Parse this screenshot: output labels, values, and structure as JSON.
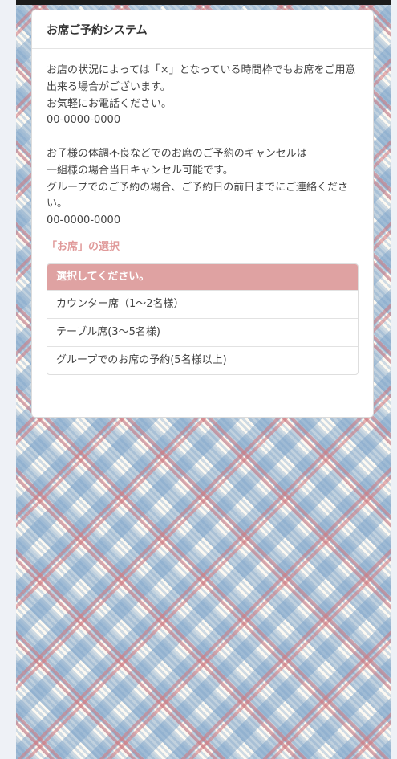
{
  "header": {
    "title": "お席ご予約システム"
  },
  "notice": {
    "lines1": [
      "お店の状況によっては「×」となっている時間枠でもお席をご用意",
      "出来る場合がございます。",
      "お気軽にお電話ください。",
      "00-0000-0000"
    ],
    "lines2": [
      "お子様の体調不良などでのお席のご予約のキャンセルは",
      "一組様の場合当日キャンセル可能です。",
      "グループでのご予約の場合、ご予約日の前日までにご連絡くださ",
      "い。",
      "00-0000-0000"
    ]
  },
  "seat_selection": {
    "title": "「お席」の選択",
    "prompt": "選択してください。",
    "options": [
      "カウンター席（1〜2名様）",
      "テーブル席(3〜5名様)",
      "グループでのお席の予約(5名様以上)"
    ]
  },
  "colors": {
    "accent": "#dfa2a2",
    "section_title": "#e09a9a",
    "pattern_red": "#d4787d",
    "pattern_blue": "#78a0c8"
  }
}
